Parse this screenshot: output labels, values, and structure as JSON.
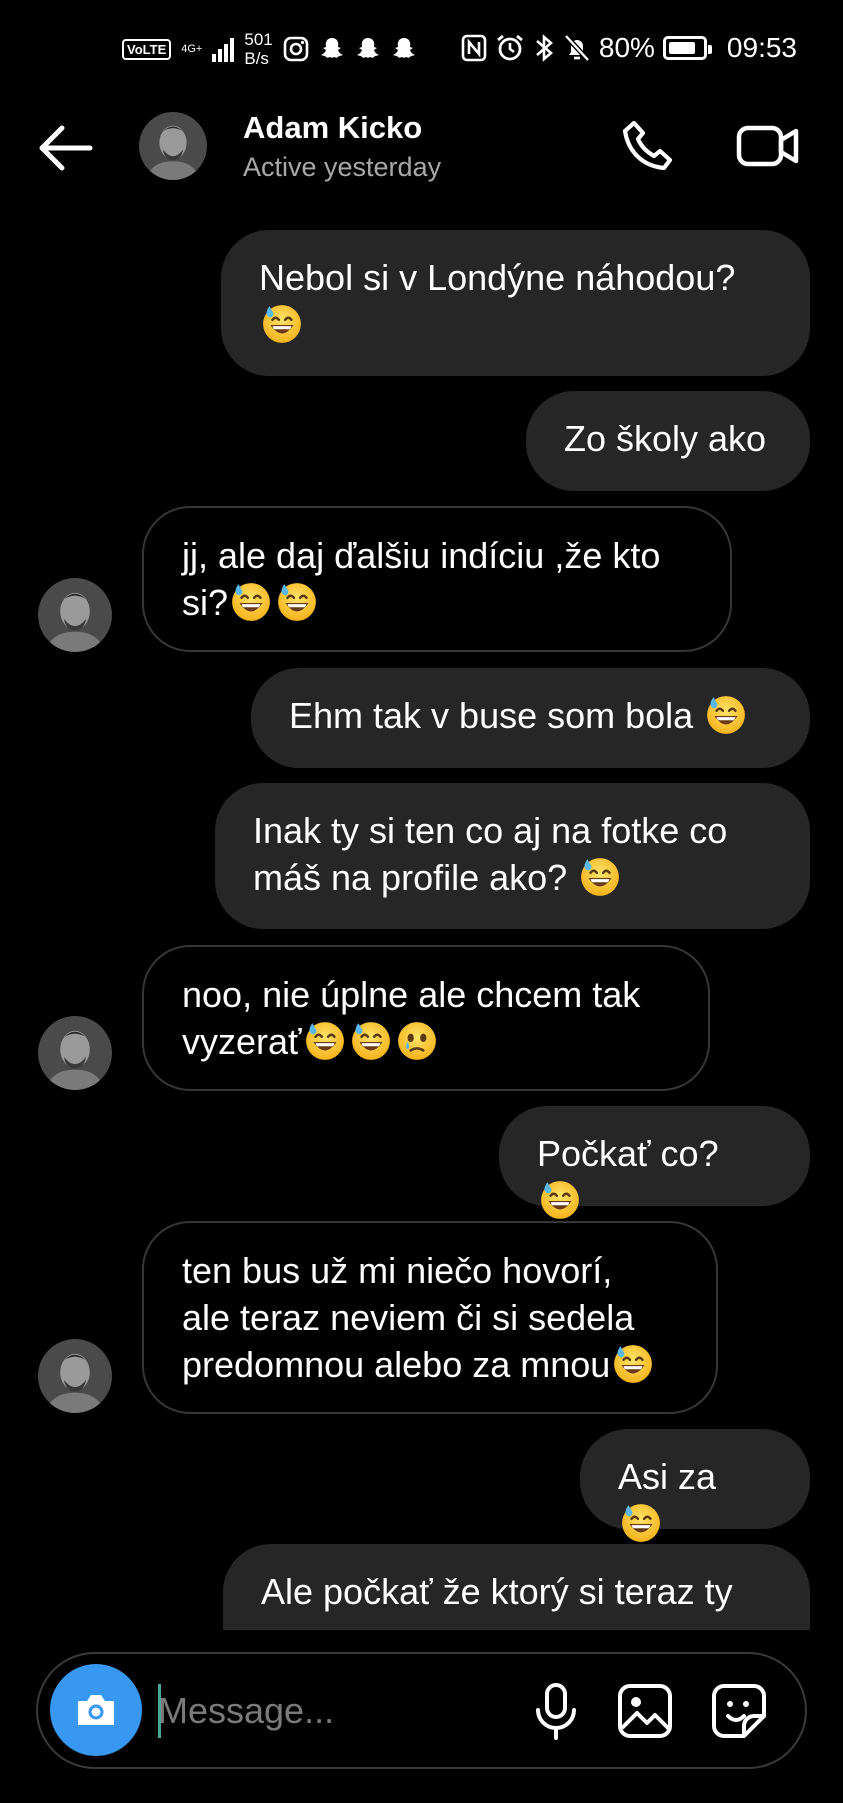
{
  "status_bar": {
    "volte": "VoLTE",
    "network": "4G+",
    "speed_value": "501",
    "speed_unit": "B/s",
    "battery": "80%",
    "battery_level": 0.8,
    "time": "09:53"
  },
  "header": {
    "contact_name": "Adam Kicko",
    "contact_status": "Active yesterday"
  },
  "messages": [
    {
      "dir": "out",
      "text": "Nebol si v Londýne náhodou?",
      "emoji_suffix": "sweat-smile"
    },
    {
      "dir": "out",
      "text": "Zo školy ako"
    },
    {
      "dir": "in",
      "text": "jj, ale daj ďalšiu indíciu ,že kto si?",
      "emoji_suffix": "sweat-smile x2"
    },
    {
      "dir": "out",
      "text": "Ehm tak v buse som bola",
      "emoji_suffix": "sweat-smile"
    },
    {
      "dir": "out",
      "text": "Inak ty si ten co aj na fotke co máš na profile ako?",
      "emoji_suffix": "sweat-smile"
    },
    {
      "dir": "in",
      "text": "noo, nie úplne ale chcem tak vyzerať",
      "emoji_suffix": "sweat-smile x2, tear-face"
    },
    {
      "dir": "out",
      "text": "Počkať co?",
      "emoji_suffix": "sweat-smile"
    },
    {
      "dir": "in",
      "text": "ten bus už mi niečo hovorí, ale teraz neviem či si sedela predomnou alebo za mnou",
      "emoji_suffix": "sweat-smile"
    },
    {
      "dir": "out",
      "text": "Asi za",
      "emoji_suffix": "sweat-smile"
    },
    {
      "dir": "out",
      "text": "Ale počkať že ktorý si teraz ty"
    }
  ],
  "m": {
    "m1a": "Nebol si v Londýne náhodou?",
    "m2": "Zo školy ako",
    "m3a": "jj, ale daj ďalšiu indíciu ,že kto",
    "m3b": "si?",
    "m4": "Ehm tak v buse som bola",
    "m5a": "Inak ty si ten co aj na fotke co",
    "m5b": "máš na profile ako?",
    "m6a": "noo, nie úplne ale chcem tak",
    "m6b": "vyzerať",
    "m7": "Počkať co?",
    "m8a": "ten bus už mi niečo hovorí,",
    "m8b": "ale teraz neviem či si sedela",
    "m8c": "predomnou alebo za mnou",
    "m9": "Asi za",
    "m10": "Ale počkať že ktorý si teraz ty"
  },
  "composer": {
    "placeholder": "Message..."
  },
  "icons": {
    "back": "arrow-left-icon",
    "call": "phone-icon",
    "video": "video-camera-icon",
    "camera": "camera-icon",
    "mic": "microphone-icon",
    "gallery": "image-icon",
    "sticker": "sticker-icon",
    "emoji_sweat": "grinning-sweat-emoji",
    "emoji_tear": "face-holding-back-tears-emoji"
  },
  "colors": {
    "background": "#000000",
    "bubble_out": "#262626",
    "bubble_in_border": "#363636",
    "camera_button": "#3897f0",
    "secondary_text": "#a8a8a8"
  }
}
